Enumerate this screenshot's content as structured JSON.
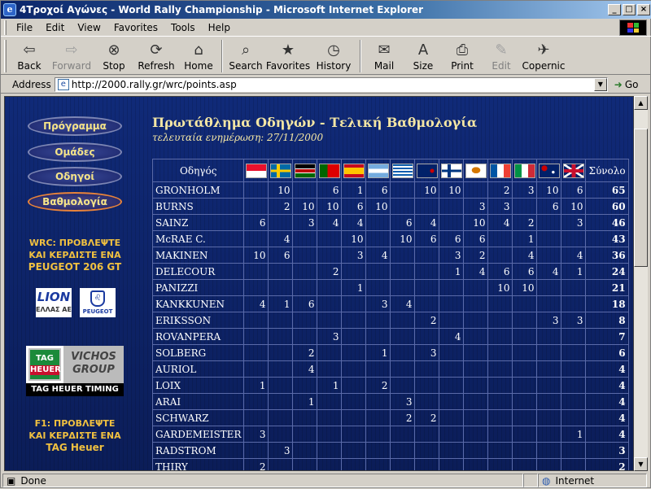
{
  "window": {
    "title": "4Τροχοί Αγώνες - World Rally Championship - Microsoft Internet Explorer"
  },
  "menu": [
    "File",
    "Edit",
    "View",
    "Favorites",
    "Tools",
    "Help"
  ],
  "toolbar": [
    {
      "label": "Back",
      "icon": "back-arrow-icon",
      "glyph": "⇦",
      "enabled": true,
      "drop": true
    },
    {
      "label": "Forward",
      "icon": "forward-arrow-icon",
      "glyph": "⇨",
      "enabled": false,
      "drop": true
    },
    {
      "label": "Stop",
      "icon": "stop-icon",
      "glyph": "⊗",
      "enabled": true
    },
    {
      "label": "Refresh",
      "icon": "refresh-icon",
      "glyph": "⟳",
      "enabled": true
    },
    {
      "label": "Home",
      "icon": "home-icon",
      "glyph": "⌂",
      "enabled": true
    },
    {
      "label": "Search",
      "icon": "search-icon",
      "glyph": "⌕",
      "enabled": true,
      "sep": true
    },
    {
      "label": "Favorites",
      "icon": "favorites-icon",
      "glyph": "★",
      "enabled": true
    },
    {
      "label": "History",
      "icon": "history-icon",
      "glyph": "◷",
      "enabled": true
    },
    {
      "label": "Mail",
      "icon": "mail-icon",
      "glyph": "✉",
      "enabled": true,
      "sep": true,
      "drop": true
    },
    {
      "label": "Size",
      "icon": "text-size-icon",
      "glyph": "A",
      "enabled": true,
      "drop": true
    },
    {
      "label": "Print",
      "icon": "print-icon",
      "glyph": "⎙",
      "enabled": true
    },
    {
      "label": "Edit",
      "icon": "edit-icon",
      "glyph": "✎",
      "enabled": false,
      "drop": true
    },
    {
      "label": "Copernic",
      "icon": "copernic-icon",
      "glyph": "✈",
      "enabled": true
    }
  ],
  "address": {
    "label": "Address",
    "url": "http://2000.rally.gr/wrc/points.asp",
    "go": "Go"
  },
  "sidebar": {
    "nav": [
      {
        "label": "Πρόγραμμα",
        "active": false
      },
      {
        "label": "Ομάδες",
        "active": false
      },
      {
        "label": "Οδηγοί",
        "active": false
      },
      {
        "label": "Βαθμολογία",
        "active": true
      }
    ],
    "promo_wrc": [
      "WRC: ΠΡΟΒΛΕΨΤΕ",
      "ΚΑΙ ΚΕΡΔΙΣΤΕ ΕΝΑ",
      "PEUGEOT 206 GT"
    ],
    "lion": {
      "main": "LION",
      "sub": "ΕΛΛΑΣ ΑΕ"
    },
    "peugeot": "PEUGEOT",
    "tag": {
      "badge1": "TAG",
      "badge2": "HEUER",
      "side": "VICHOS GROUP",
      "bottom": "TAG HEUER TIMING"
    },
    "promo_f1": [
      "F1: ΠΡΟΒΛΕΨΤΕ",
      "ΚΑΙ ΚΕΡΔΙΣΤΕ ΕΝΑ",
      "TAG Heuer"
    ]
  },
  "main": {
    "title": "Πρωτάθλημα Οδηγών - Τελική Βαθμολογία",
    "updated": "τελευταία ενημέρωση: 27/11/2000",
    "driver_header": "Οδηγός",
    "total_header": "Σύνολο",
    "flags": [
      "monaco",
      "sweden",
      "kenya",
      "portugal",
      "spain",
      "argentina",
      "greece",
      "new-zealand",
      "finland",
      "cyprus",
      "france",
      "italy",
      "australia",
      "great-britain"
    ],
    "rows": [
      {
        "name": "GRONHOLM",
        "pts": [
          "",
          "10",
          "",
          "6",
          "1",
          "6",
          "",
          "10",
          "10",
          "",
          "2",
          "3",
          "10",
          "6"
        ],
        "total": "65"
      },
      {
        "name": "BURNS",
        "pts": [
          "",
          "2",
          "10",
          "10",
          "6",
          "10",
          "",
          "",
          "",
          "3",
          "3",
          "",
          "6",
          "10"
        ],
        "total": "60"
      },
      {
        "name": "SAINZ",
        "pts": [
          "6",
          "",
          "3",
          "4",
          "4",
          "",
          "6",
          "4",
          "",
          "10",
          "4",
          "2",
          "",
          "3"
        ],
        "total": "46"
      },
      {
        "name": "McRAE C.",
        "pts": [
          "",
          "4",
          "",
          "",
          "10",
          "",
          "10",
          "6",
          "6",
          "6",
          "",
          "1",
          "",
          ""
        ],
        "total": "43"
      },
      {
        "name": "MAKINEN",
        "pts": [
          "10",
          "6",
          "",
          "",
          "3",
          "4",
          "",
          "",
          "3",
          "2",
          "",
          "4",
          "",
          "4"
        ],
        "total": "36"
      },
      {
        "name": "DELECOUR",
        "pts": [
          "",
          "",
          "",
          "2",
          "",
          "",
          "",
          "",
          "1",
          "4",
          "6",
          "6",
          "4",
          "1"
        ],
        "total": "24"
      },
      {
        "name": "PANIZZI",
        "pts": [
          "",
          "",
          "",
          "",
          "1",
          "",
          "",
          "",
          "",
          "",
          "10",
          "10",
          "",
          ""
        ],
        "total": "21"
      },
      {
        "name": "KANKKUNEN",
        "pts": [
          "4",
          "1",
          "6",
          "",
          "",
          "3",
          "4",
          "",
          "",
          "",
          "",
          "",
          "",
          ""
        ],
        "total": "18"
      },
      {
        "name": "ERIKSSON",
        "pts": [
          "",
          "",
          "",
          "",
          "",
          "",
          "",
          "2",
          "",
          "",
          "",
          "",
          "3",
          "3"
        ],
        "total": "8"
      },
      {
        "name": "ROVANPERA",
        "pts": [
          "",
          "",
          "",
          "3",
          "",
          "",
          "",
          "",
          "4",
          "",
          "",
          "",
          "",
          ""
        ],
        "total": "7"
      },
      {
        "name": "SOLBERG",
        "pts": [
          "",
          "",
          "2",
          "",
          "",
          "1",
          "",
          "3",
          "",
          "",
          "",
          "",
          "",
          ""
        ],
        "total": "6"
      },
      {
        "name": "AURIOL",
        "pts": [
          "",
          "",
          "4",
          "",
          "",
          "",
          "",
          "",
          "",
          "",
          "",
          "",
          "",
          ""
        ],
        "total": "4"
      },
      {
        "name": "LOIX",
        "pts": [
          "1",
          "",
          "",
          "1",
          "",
          "2",
          "",
          "",
          "",
          "",
          "",
          "",
          "",
          ""
        ],
        "total": "4"
      },
      {
        "name": "ARAI",
        "pts": [
          "",
          "",
          "1",
          "",
          "",
          "",
          "3",
          "",
          "",
          "",
          "",
          "",
          "",
          ""
        ],
        "total": "4"
      },
      {
        "name": "SCHWARZ",
        "pts": [
          "",
          "",
          "",
          "",
          "",
          "",
          "2",
          "2",
          "",
          "",
          "",
          "",
          "",
          ""
        ],
        "total": "4"
      },
      {
        "name": "GARDEMEISTER",
        "pts": [
          "3",
          "",
          "",
          "",
          "",
          "",
          "",
          "",
          "",
          "",
          "",
          "",
          "",
          "1"
        ],
        "total": "4"
      },
      {
        "name": "RADSTROM",
        "pts": [
          "",
          "3",
          "",
          "",
          "",
          "",
          "",
          "",
          "",
          "",
          "",
          "",
          "",
          ""
        ],
        "total": "3"
      },
      {
        "name": "THIRY",
        "pts": [
          "2",
          "",
          "",
          "",
          "",
          "",
          "",
          "",
          "",
          "",
          "",
          "",
          "",
          ""
        ],
        "total": "2"
      }
    ]
  },
  "status": {
    "left": "Done",
    "zone": "Internet"
  }
}
